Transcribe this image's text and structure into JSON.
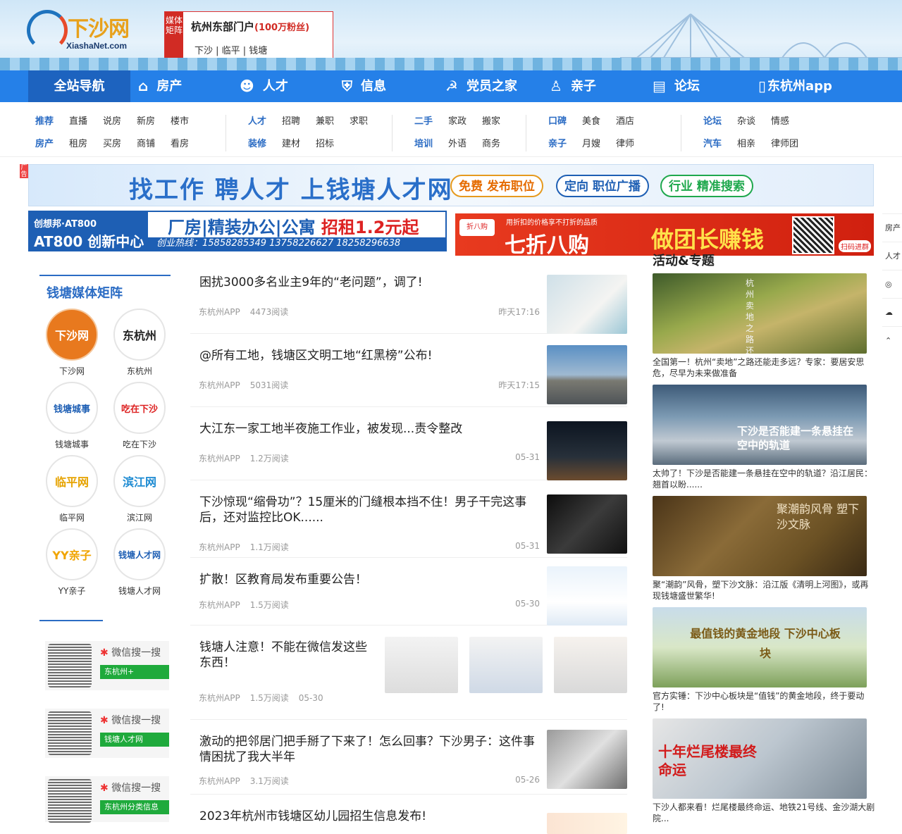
{
  "header": {
    "logo_text": "下沙网",
    "logo_domain": "XiashaNet.com",
    "portal_tag": "媒体矩阵",
    "portal_title": "杭州东部门户",
    "portal_fans": "(100万粉丝)",
    "portal_areas": "下沙 | 临平 | 钱塘"
  },
  "nav": {
    "items": [
      {
        "label": "全站导航",
        "icon": "menu-icon"
      },
      {
        "label": "房产",
        "icon": "home-icon"
      },
      {
        "label": "人才",
        "icon": "people-icon"
      },
      {
        "label": "信息",
        "icon": "shield-icon"
      },
      {
        "label": "党员之家",
        "icon": "party-icon"
      },
      {
        "label": "亲子",
        "icon": "family-icon"
      },
      {
        "label": "论坛",
        "icon": "chat-icon"
      },
      {
        "label": "东杭州app",
        "icon": "phone-icon"
      }
    ]
  },
  "subnav": {
    "groups": [
      {
        "row1": [
          "推荐",
          "直播",
          "说房",
          "新房",
          "楼市"
        ],
        "row2": [
          "房产",
          "租房",
          "买房",
          "商铺",
          "看房"
        ]
      },
      {
        "row1": [
          "人才",
          "招聘",
          "兼职",
          "求职"
        ],
        "row2": [
          "装修",
          "建材",
          "招标"
        ]
      },
      {
        "row1": [
          "二手",
          "家政",
          "搬家"
        ],
        "row2": [
          "培训",
          "外语",
          "商务"
        ]
      },
      {
        "row1": [
          "口碑",
          "美食",
          "酒店"
        ],
        "row2": [
          "亲子",
          "月嫂",
          "律师"
        ]
      },
      {
        "row1": [
          "论坛",
          "杂谈",
          "情感"
        ],
        "row2": [
          "汽车",
          "相亲",
          "律师团"
        ]
      }
    ]
  },
  "ads": {
    "flag": "广告",
    "banner1": {
      "headline": "找工作 聘人才 上钱塘人才网",
      "pills": [
        "免费 发布职位",
        "定向 职位广播",
        "行业 精准搜索"
      ]
    },
    "banner2": {
      "brand1": "创想邦·AT800",
      "brand2": "AT800 创新中心",
      "headline": "厂房|精装办公|公寓",
      "price": "招租1.2元起",
      "hotline": "创业热线：15858285349  13758226627  18258296638"
    },
    "banner3": {
      "logo": "折八购",
      "small": "用折扣的价格享不打折的品质",
      "title": "七折八购",
      "slogan": "做团长赚钱",
      "scan": "扫码进群"
    }
  },
  "sidebar": {
    "title": "钱塘媒体矩阵",
    "media": [
      {
        "logo": "下沙网",
        "name": "下沙网",
        "bg": "#e8791e",
        "fg": "#fff"
      },
      {
        "logo": "东杭州",
        "name": "东杭州",
        "bg": "#fff",
        "fg": "#222"
      },
      {
        "logo": "钱塘城事",
        "name": "钱塘城事",
        "bg": "#fff",
        "fg": "#1e5fb4"
      },
      {
        "logo": "吃在下沙",
        "name": "吃在下沙",
        "bg": "#fff",
        "fg": "#d22"
      },
      {
        "logo": "临平网",
        "name": "临平网",
        "bg": "#fff",
        "fg": "#e6a300"
      },
      {
        "logo": "滨江网",
        "name": "滨江网",
        "bg": "#fff",
        "fg": "#1e8bd2"
      },
      {
        "logo": "YY亲子",
        "name": "YY亲子",
        "bg": "#fff",
        "fg": "#f0a400"
      },
      {
        "logo": "钱塘人才网",
        "name": "钱塘人才网",
        "bg": "#fff",
        "fg": "#1e5fb4"
      }
    ],
    "wechat": [
      {
        "label": "微信搜一搜",
        "search": "东杭州+"
      },
      {
        "label": "微信搜一搜",
        "search": "钱塘人才网"
      },
      {
        "label": "微信搜一搜",
        "search": "东杭州分类信息"
      }
    ]
  },
  "feed": [
    {
      "title": "困扰3000多名业主9年的“老问题”，调了!",
      "source": "东杭州APP",
      "reads": "4473阅读",
      "date": "昨天17:16"
    },
    {
      "title": "@所有工地，钱塘区文明工地“红黑榜”公布!",
      "source": "东杭州APP",
      "reads": "5031阅读",
      "date": "昨天17:15"
    },
    {
      "title": "大江东一家工地半夜施工作业，被发现...责令整改",
      "source": "东杭州APP",
      "reads": "1.2万阅读",
      "date": "05-31"
    },
    {
      "title": "下沙惊现“缩骨功”？15厘米的门缝根本挡不住！男子干完这事后，还对监控比OK......",
      "source": "东杭州APP",
      "reads": "1.1万阅读",
      "date": "05-31"
    },
    {
      "title": "扩散！区教育局发布重要公告！",
      "source": "东杭州APP",
      "reads": "1.5万阅读",
      "date": "05-30"
    },
    {
      "title": "钱塘人注意！不能在微信发这些东西！",
      "source": "东杭州APP",
      "reads": "1.5万阅读",
      "date": "05-30"
    },
    {
      "title": "激动的把邻居门把手掰了下来了！怎么回事？下沙男子：这件事情困扰了我大半年",
      "source": "东杭州APP",
      "reads": "3.1万阅读",
      "date": "05-26"
    },
    {
      "title": "2023年杭州市钱塘区幼儿园招生信息发布!",
      "source": "",
      "reads": "",
      "date": ""
    }
  ],
  "right": {
    "title": "活动&专题",
    "cards": [
      {
        "caption": "全国第一！杭州“卖地”之路还能走多远？专家：要居安思危，尽早为未来做准备",
        "overlay": "杭州卖地之路还能走多远"
      },
      {
        "caption": "太帅了！下沙是否能建一条悬挂在空中的轨道？沿江居民：翘首以盼......",
        "overlay": "下沙是否能建一条悬挂在空中的轨道"
      },
      {
        "caption": "聚“潮韵”风骨，塑下沙文脉：沿江版《清明上河图》，或再现钱塘盛世繁华!",
        "overlay": "聚潮韵风骨 塑下沙文脉"
      },
      {
        "caption": "官方实锤：下沙中心板块是“值钱”的黄金地段，终于要动了!",
        "overlay": "最值钱的黄金地段 下沙中心板块"
      },
      {
        "caption": "下沙人都来看！烂尾楼最终命运、地铁21号线、金沙湖大剧院...",
        "overlay": "十年烂尾楼最终命运"
      }
    ]
  },
  "floatbar": {
    "items": [
      "房产",
      "人才"
    ]
  }
}
